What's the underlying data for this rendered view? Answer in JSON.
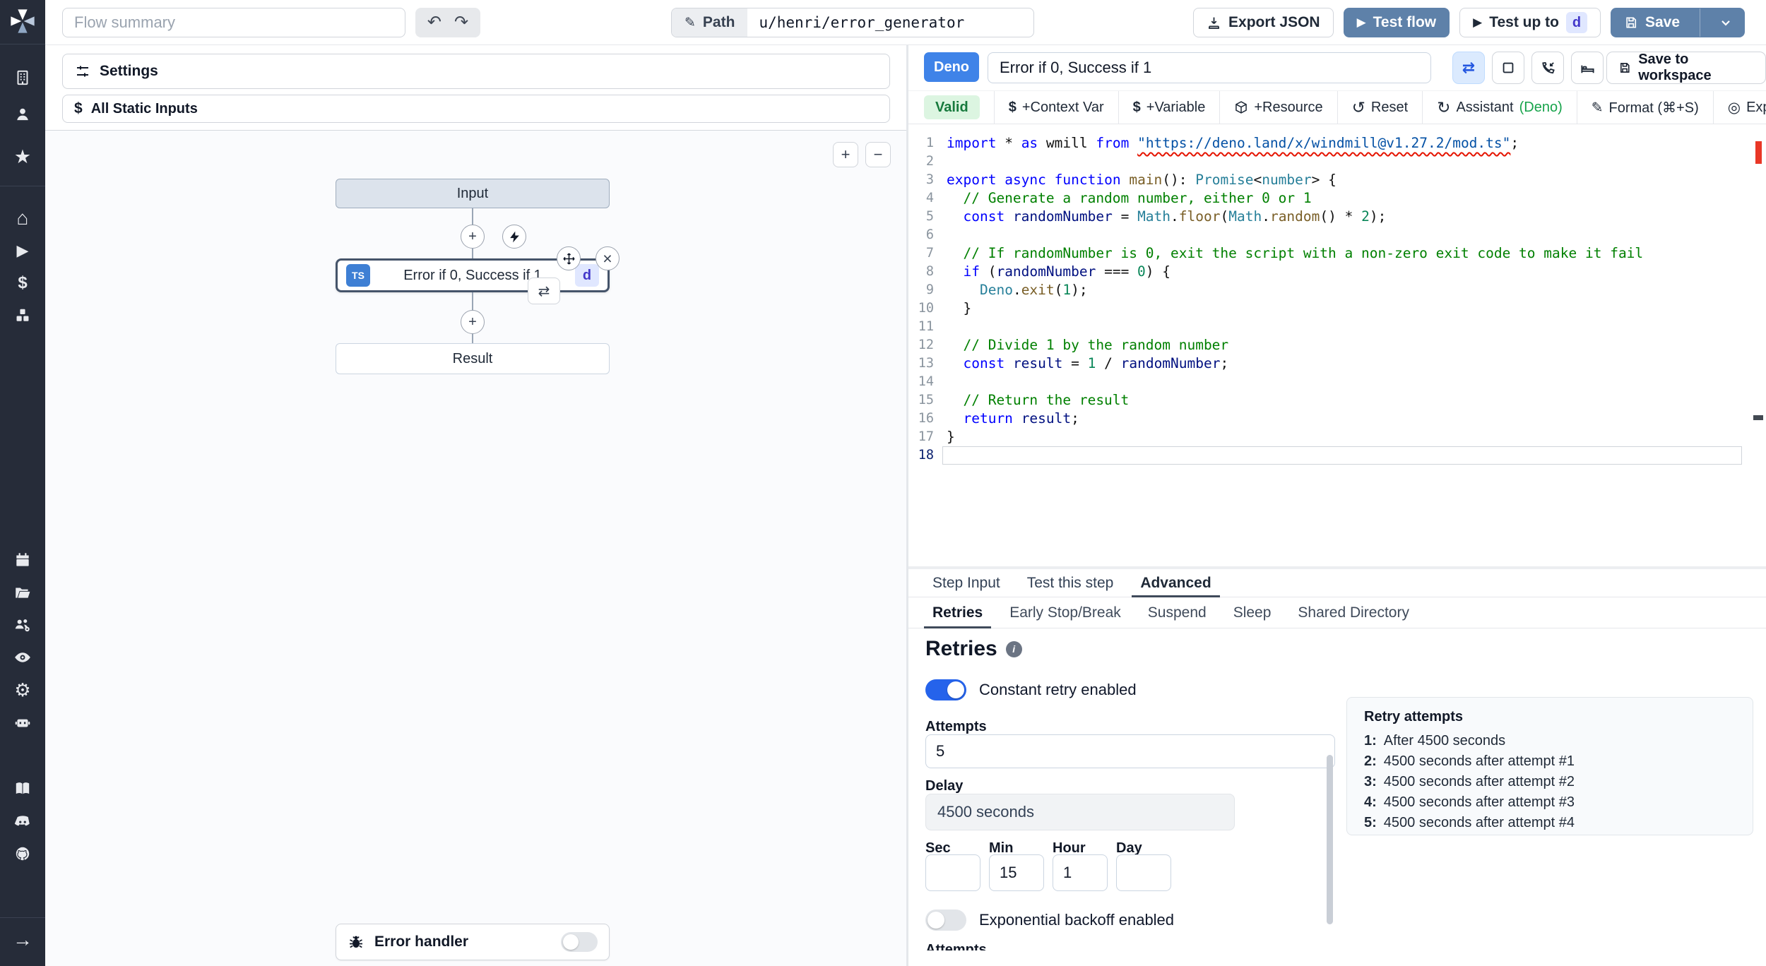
{
  "icons": {
    "undo": "↶",
    "redo": "↷",
    "play": "▶",
    "chevron-down": "v",
    "pencil": "✎",
    "plus": "+",
    "minus": "−",
    "close": "×",
    "repeat": "⇄",
    "reset": "↺",
    "assistant-refresh": "↻",
    "format-pencil": "✎",
    "explore-target": "◎",
    "star": "★",
    "home": "⌂",
    "dollar": "$",
    "gear": "⚙",
    "arrow-right": "→"
  },
  "topbar": {
    "flow_summary_placeholder": "Flow summary",
    "path_label": "Path",
    "path_value": "u/henri/error_generator",
    "export_json_label": "Export JSON",
    "test_flow_label": "Test flow",
    "test_up_to_label": "Test up to",
    "test_up_to_badge": "d",
    "save_label": "Save"
  },
  "flow_panel": {
    "settings_label": "Settings",
    "all_static_inputs_label": "All Static Inputs",
    "zoom_in": "+",
    "zoom_out": "−",
    "nodes": {
      "input_label": "Input",
      "step_lang_badge": "TS",
      "step_label": "Error if 0, Success if 1",
      "step_id_badge": "d",
      "result_label": "Result"
    },
    "error_handler_label": "Error handler"
  },
  "editor_panel": {
    "lang_badge": "Deno",
    "step_name_value": "Error if 0, Success if 1",
    "save_to_workspace_label": "Save to workspace",
    "toolbar": {
      "valid_label": "Valid",
      "context_var_label": "+Context Var",
      "variable_label": "+Variable",
      "resource_label": "+Resource",
      "reset_label": "Reset",
      "assistant_label": "Assistant",
      "assistant_lang": "(Deno)",
      "format_label": "Format (⌘+S)",
      "explore_label": "Explore other s"
    },
    "code": {
      "lines": [
        {
          "n": 1,
          "s": [
            [
              "k",
              "import"
            ],
            [
              "p",
              " * "
            ],
            [
              "k",
              "as"
            ],
            [
              "p",
              " wmill "
            ],
            [
              "k",
              "from"
            ],
            [
              "p",
              " "
            ],
            [
              "u",
              "\"https://deno.land/x/windmill@v1.27.2/mod.ts\""
            ],
            [
              "p",
              ";"
            ]
          ]
        },
        {
          "n": 2,
          "s": []
        },
        {
          "n": 3,
          "s": [
            [
              "k",
              "export"
            ],
            [
              "p",
              " "
            ],
            [
              "k",
              "async"
            ],
            [
              "p",
              " "
            ],
            [
              "k",
              "function"
            ],
            [
              "p",
              " "
            ],
            [
              "f",
              "main"
            ],
            [
              "p",
              "(): "
            ],
            [
              "t",
              "Promise"
            ],
            [
              "p",
              "<"
            ],
            [
              "t",
              "number"
            ],
            [
              "p",
              "> {"
            ]
          ]
        },
        {
          "n": 4,
          "s": [
            [
              "c",
              "  // Generate a random number, either 0 or 1"
            ]
          ]
        },
        {
          "n": 5,
          "s": [
            [
              "p",
              "  "
            ],
            [
              "k",
              "const"
            ],
            [
              "p",
              " "
            ],
            [
              "v",
              "randomNumber"
            ],
            [
              "p",
              " = "
            ],
            [
              "t",
              "Math"
            ],
            [
              "p",
              "."
            ],
            [
              "f",
              "floor"
            ],
            [
              "p",
              "("
            ],
            [
              "t",
              "Math"
            ],
            [
              "p",
              "."
            ],
            [
              "f",
              "random"
            ],
            [
              "p",
              "() * "
            ],
            [
              "n",
              "2"
            ],
            [
              "p",
              ");"
            ]
          ]
        },
        {
          "n": 6,
          "s": []
        },
        {
          "n": 7,
          "s": [
            [
              "c",
              "  // If randomNumber is 0, exit the script with a non-zero exit code to make it fail"
            ]
          ]
        },
        {
          "n": 8,
          "s": [
            [
              "p",
              "  "
            ],
            [
              "k",
              "if"
            ],
            [
              "p",
              " ("
            ],
            [
              "v",
              "randomNumber"
            ],
            [
              "p",
              " === "
            ],
            [
              "n",
              "0"
            ],
            [
              "p",
              ") {"
            ]
          ]
        },
        {
          "n": 9,
          "s": [
            [
              "p",
              "    "
            ],
            [
              "t",
              "Deno"
            ],
            [
              "p",
              "."
            ],
            [
              "f",
              "exit"
            ],
            [
              "p",
              "("
            ],
            [
              "n",
              "1"
            ],
            [
              "p",
              ");"
            ]
          ]
        },
        {
          "n": 10,
          "s": [
            [
              "p",
              "  }"
            ]
          ]
        },
        {
          "n": 11,
          "s": []
        },
        {
          "n": 12,
          "s": [
            [
              "c",
              "  // Divide 1 by the random number"
            ]
          ]
        },
        {
          "n": 13,
          "s": [
            [
              "p",
              "  "
            ],
            [
              "k",
              "const"
            ],
            [
              "p",
              " "
            ],
            [
              "v",
              "result"
            ],
            [
              "p",
              " = "
            ],
            [
              "n",
              "1"
            ],
            [
              "p",
              " / "
            ],
            [
              "v",
              "randomNumber"
            ],
            [
              "p",
              ";"
            ]
          ]
        },
        {
          "n": 14,
          "s": []
        },
        {
          "n": 15,
          "s": [
            [
              "c",
              "  // Return the result"
            ]
          ]
        },
        {
          "n": 16,
          "s": [
            [
              "p",
              "  "
            ],
            [
              "k",
              "return"
            ],
            [
              "p",
              " "
            ],
            [
              "v",
              "result"
            ],
            [
              "p",
              ";"
            ]
          ]
        },
        {
          "n": 17,
          "s": [
            [
              "p",
              "}"
            ]
          ]
        },
        {
          "n": 18,
          "a": true,
          "s": []
        }
      ]
    }
  },
  "bottom_panel": {
    "tabs": [
      "Step Input",
      "Test this step",
      "Advanced"
    ],
    "active_tab": "Advanced",
    "subtabs": [
      "Retries",
      "Early Stop/Break",
      "Suspend",
      "Sleep",
      "Shared Directory"
    ],
    "active_subtab": "Retries",
    "retries": {
      "heading": "Retries",
      "constant_toggle_label": "Constant retry enabled",
      "constant_on": true,
      "attempts_label": "Attempts",
      "attempts_value": "5",
      "delay_label": "Delay",
      "delay_value": "4500 seconds",
      "time_fields": [
        {
          "label": "Sec",
          "value": ""
        },
        {
          "label": "Min",
          "value": "15"
        },
        {
          "label": "Hour",
          "value": "1"
        },
        {
          "label": "Day",
          "value": ""
        }
      ],
      "exponential_toggle_label": "Exponential backoff enabled",
      "exponential_on": false,
      "bottom_cut_label": "Attempts",
      "preview": {
        "title": "Retry attempts",
        "items": [
          {
            "n": "1:",
            "t": "After 4500 seconds"
          },
          {
            "n": "2:",
            "t": "4500 seconds after attempt #1"
          },
          {
            "n": "3:",
            "t": "4500 seconds after attempt #2"
          },
          {
            "n": "4:",
            "t": "4500 seconds after attempt #3"
          },
          {
            "n": "5:",
            "t": "4500 seconds after attempt #4"
          }
        ]
      }
    }
  },
  "colors": {
    "accent_blue": "#5e81a9",
    "bright_blue": "#3f83e8",
    "toggle_on": "#2563eb",
    "ts_badge": "#3e7fd4",
    "badge_indigo_bg": "#e0e7ff",
    "badge_indigo_text": "#4338ca",
    "valid_green_bg": "#dcf5e1",
    "valid_green_text": "#177a3d",
    "sidebar_bg": "#262c39",
    "error_red": "#e51400"
  }
}
